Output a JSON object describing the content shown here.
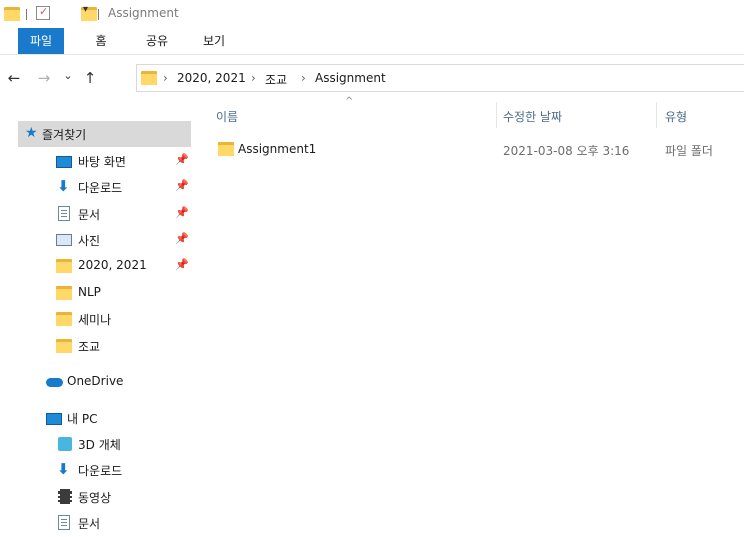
{
  "window": {
    "title": "Assignment"
  },
  "ribbon": {
    "tabs": [
      "파일",
      "홈",
      "공유",
      "보기"
    ]
  },
  "nav": {
    "back_glyph": "←",
    "forward_glyph": "→",
    "recent_glyph": "⌄",
    "up_glyph": "↑"
  },
  "address": {
    "crumbs": [
      "2020, 2021",
      "조교",
      "Assignment"
    ]
  },
  "columns": {
    "name": "이름",
    "date": "수정한 날짜",
    "type": "유형"
  },
  "sidebar": {
    "quick_access": "즐겨찾기",
    "items": [
      {
        "label": "바탕 화면",
        "icon": "desktop-icon",
        "pinned": true
      },
      {
        "label": "다운로드",
        "icon": "download-arrow-icon",
        "pinned": true
      },
      {
        "label": "문서",
        "icon": "document-icon",
        "pinned": true
      },
      {
        "label": "사진",
        "icon": "picture-icon",
        "pinned": true
      },
      {
        "label": "2020, 2021",
        "icon": "folder-icon",
        "pinned": true
      },
      {
        "label": "NLP",
        "icon": "folder-icon",
        "pinned": false
      },
      {
        "label": "세미나",
        "icon": "folder-icon",
        "pinned": false
      },
      {
        "label": "조교",
        "icon": "folder-icon",
        "pinned": false
      }
    ],
    "onedrive": "OneDrive",
    "this_pc": "내 PC",
    "pc_items": [
      {
        "label": "3D 개체",
        "icon": "cube-icon"
      },
      {
        "label": "다운로드",
        "icon": "download-arrow-icon"
      },
      {
        "label": "동영상",
        "icon": "film-icon"
      },
      {
        "label": "문서",
        "icon": "document-icon"
      }
    ]
  },
  "files": [
    {
      "name": "Assignment1",
      "modified": "2021-03-08 오후 3:16",
      "type": "파일 폴더"
    }
  ]
}
